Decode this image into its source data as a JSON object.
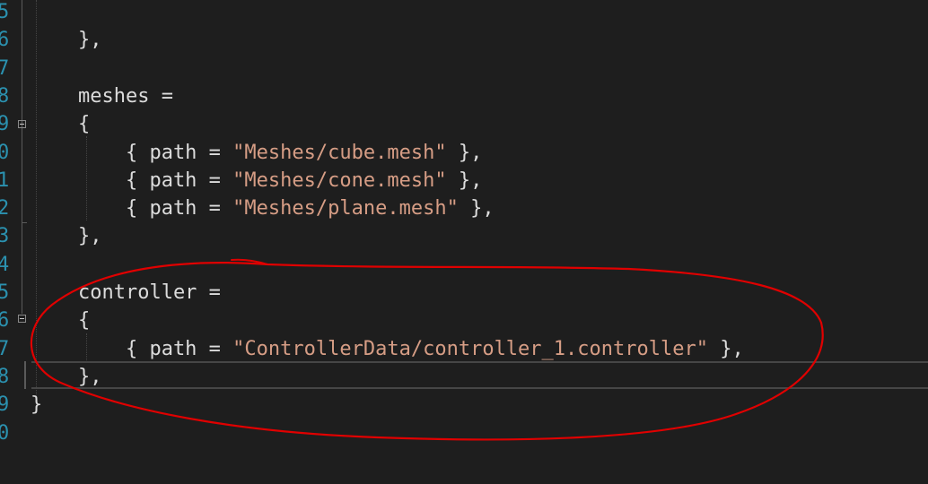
{
  "line_numbers": [
    "5",
    "6",
    "7",
    "8",
    "9",
    "0",
    "1",
    "2",
    "3",
    "4",
    "5",
    "6",
    "7",
    "8",
    "9",
    "0"
  ],
  "code_lines": [
    [
      {
        "t": ""
      }
    ],
    [
      {
        "t": "    },"
      }
    ],
    [
      {
        "t": ""
      }
    ],
    [
      {
        "t": "    meshes ="
      }
    ],
    [
      {
        "t": "    {"
      }
    ],
    [
      {
        "t": "        { path = "
      },
      {
        "t": "\"Meshes/cube.mesh\"",
        "s": 1
      },
      {
        "t": " },"
      }
    ],
    [
      {
        "t": "        { path = "
      },
      {
        "t": "\"Meshes/cone.mesh\"",
        "s": 1
      },
      {
        "t": " },"
      }
    ],
    [
      {
        "t": "        { path = "
      },
      {
        "t": "\"Meshes/plane.mesh\"",
        "s": 1
      },
      {
        "t": " },"
      }
    ],
    [
      {
        "t": "    },"
      }
    ],
    [
      {
        "t": ""
      }
    ],
    [
      {
        "t": "    controller ="
      }
    ],
    [
      {
        "t": "    {"
      }
    ],
    [
      {
        "t": "        { path = "
      },
      {
        "t": "\"ControllerData/controller_1.controller\"",
        "s": 1
      },
      {
        "t": " },"
      }
    ],
    [
      {
        "t": "    },"
      }
    ],
    [
      {
        "t": "}"
      }
    ],
    [
      {
        "t": ""
      }
    ]
  ],
  "colors": {
    "background": "#1e1e1e",
    "line_number": "#2b91af",
    "text": "#dcdcdc",
    "string": "#d69d85",
    "annotation": "#e00000"
  },
  "icons": [
    "fold-collapse-icon"
  ]
}
